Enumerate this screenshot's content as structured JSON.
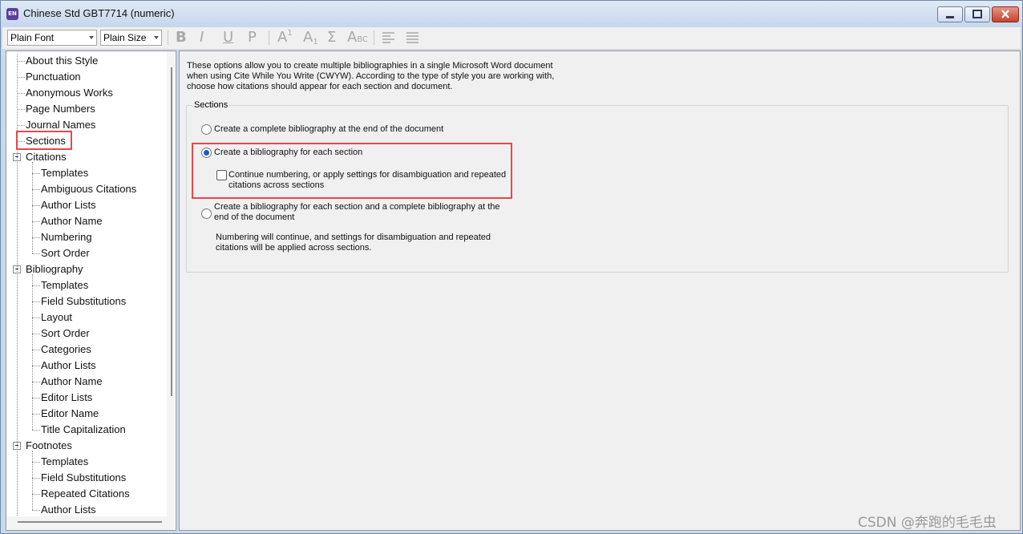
{
  "window": {
    "title": "Chinese Std GBT7714 (numeric)",
    "app_icon": "EN",
    "colors": {
      "title_bar": "#c6d7ec",
      "close_button": "#c4422e",
      "highlight_box": "#e8474b",
      "radio_selected": "#1560c8"
    }
  },
  "toolbar": {
    "font_select": "Plain Font",
    "size_select": "Plain Size",
    "bold": "B",
    "italic": "I",
    "underline": "U",
    "plain": "P",
    "superscript": "A",
    "superscript_mark": "1",
    "subscript": "A",
    "subscript_mark": "1",
    "symbol": "Σ",
    "small_caps": "A",
    "small_caps_mark": "BC",
    "align_left_icon": "align-left-icon",
    "justify_icon": "justify-icon"
  },
  "tree": {
    "items": [
      "About this Style",
      "Punctuation",
      "Anonymous Works",
      "Page Numbers",
      "Journal Names",
      "Sections",
      "Citations",
      "Templates",
      "Ambiguous Citations",
      "Author Lists",
      "Author Name",
      "Numbering",
      "Sort Order",
      "Bibliography",
      "Templates",
      "Field Substitutions",
      "Layout",
      "Sort Order",
      "Categories",
      "Author Lists",
      "Author Name",
      "Editor Lists",
      "Editor Name",
      "Title Capitalization",
      "Footnotes",
      "Templates",
      "Field Substitutions",
      "Repeated Citations",
      "Author Lists"
    ]
  },
  "content": {
    "intro": "These options allow you to create multiple bibliographies in a single Microsoft Word document when using Cite While You Write (CWYW). According to the type of style you are working with, choose how citations should appear for each section and document.",
    "sections_label": "Sections",
    "option1": "Create a complete bibliography at the end of the document",
    "option2": "Create a bibliography for each section",
    "option2_sub": "Continue numbering, or apply settings for disambiguation and repeated citations across sections",
    "option3": "Create a bibliography for each section and a complete bibliography at the end of the document",
    "option3_note": "Numbering will continue, and settings for disambiguation and repeated citations will be applied across sections.",
    "selected_option": 2,
    "option2_sub_checked": false
  },
  "watermark": "CSDN @奔跑的毛毛虫"
}
